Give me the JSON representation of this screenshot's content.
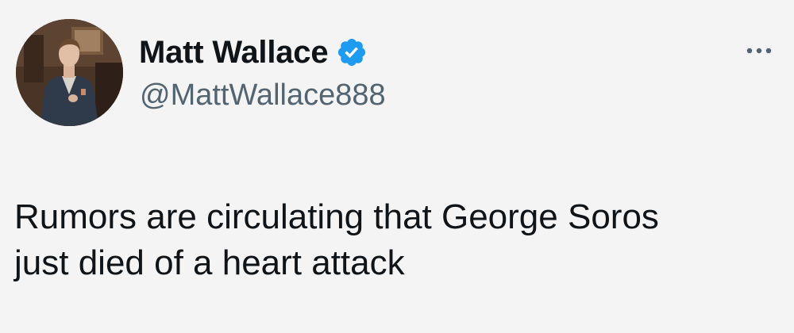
{
  "author": {
    "display_name": "Matt Wallace",
    "handle": "@MattWallace888",
    "verified": true
  },
  "tweet": {
    "text": "Rumors are circulating that George Soros\njust died of a heart attack"
  },
  "icons": {
    "verified": "verified-badge-icon",
    "more": "more-options-icon"
  },
  "colors": {
    "background": "#f4f4f4",
    "text": "#0f1419",
    "secondary_text": "#536471",
    "verified_blue": "#1d9bf0"
  }
}
